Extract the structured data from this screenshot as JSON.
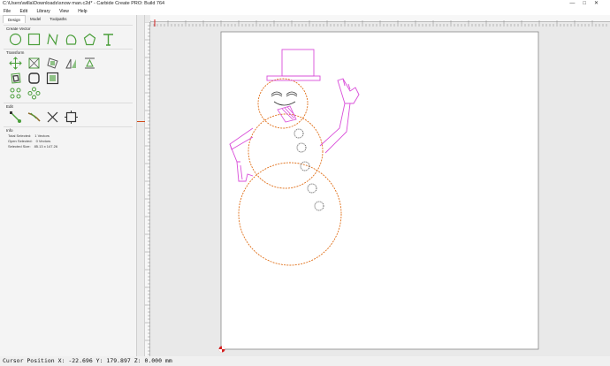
{
  "window": {
    "title": "C:\\Users\\willa\\Downloads\\snow man.c2d* - Carbide Create PRO: Build 764"
  },
  "menu": {
    "items": [
      "File",
      "Edit",
      "Library",
      "View",
      "Help"
    ]
  },
  "tabs": [
    {
      "label": "Design",
      "active": true
    },
    {
      "label": "Model",
      "active": false
    },
    {
      "label": "Toolpaths",
      "active": false
    }
  ],
  "sections": {
    "create_vector": "Create Vector",
    "transform": "Transform",
    "edit": "Edit",
    "info": "Info"
  },
  "icons": {
    "create_vector": [
      "circle-icon",
      "rectangle-icon",
      "polyline-icon",
      "curve-icon",
      "polygon-icon",
      "text-icon"
    ],
    "transform_row1": [
      "move-icon",
      "scale-icon",
      "rotate-icon",
      "mirror-icon",
      "align-icon"
    ],
    "transform_row2": [
      "offset-icon",
      "fillet-icon",
      "boolean-icon"
    ],
    "transform_row3": [
      "array-icon",
      "circular-array-icon"
    ],
    "edit": [
      "node-edit-icon",
      "trim-icon",
      "cut-icon",
      "box-select-icon"
    ]
  },
  "info": {
    "total_selected_label": "Total Selected:",
    "total_selected_value": "1 Vectors",
    "open_selected_label": "Open Selected:",
    "open_selected_value": "0 Vectors",
    "selected_size_label": "Selected Size:",
    "selected_size_value": "85.13 x 147.26"
  },
  "status": {
    "text": "Cursor Position X: -22.696 Y: 179.897 Z: 0.000 mm"
  },
  "colors": {
    "accent_green": "#4a9e3a",
    "shape_orange": "#e0701a",
    "shape_magenta": "#d94ed9",
    "origin_red": "#d42020"
  }
}
